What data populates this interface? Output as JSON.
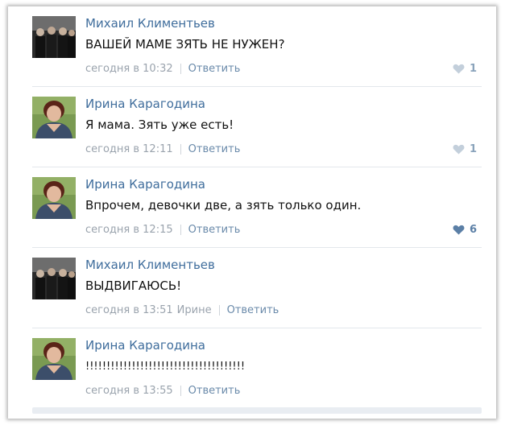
{
  "colors": {
    "author": "#3f6d9c",
    "meta": "#9aa3ad",
    "like_inactive": "#c3cfdb",
    "like_active": "#5b7fa6"
  },
  "comments": [
    {
      "author": "Михаил Климентьев",
      "avatar": "group-photo-avatar",
      "text": "ВАШЕЙ МАМЕ ЗЯТЬ НЕ НУЖЕН?",
      "time": "сегодня в 10:32",
      "reply_to": "",
      "reply_label": "Ответить",
      "likes": "1",
      "liked": false
    },
    {
      "author": "Ирина Карагодина",
      "avatar": "woman-portrait-avatar",
      "text": "Я мама. Зять уже есть!",
      "time": "сегодня в 12:11",
      "reply_to": "",
      "reply_label": "Ответить",
      "likes": "1",
      "liked": false
    },
    {
      "author": "Ирина Карагодина",
      "avatar": "woman-portrait-avatar",
      "text": "Впрочем, девочки две, а зять только один.",
      "time": "сегодня в 12:15",
      "reply_to": "",
      "reply_label": "Ответить",
      "likes": "6",
      "liked": true
    },
    {
      "author": "Михаил Климентьев",
      "avatar": "group-photo-avatar",
      "text": "ВЫДВИГАЮСЬ!",
      "time": "сегодня в 13:51",
      "reply_to": "Ирине",
      "reply_label": "Ответить",
      "likes": "",
      "liked": false
    },
    {
      "author": "Ирина Карагодина",
      "avatar": "woman-portrait-avatar",
      "text": "!!!!!!!!!!!!!!!!!!!!!!!!!!!!!!!!!!!!!!",
      "time": "сегодня в 13:55",
      "reply_to": "",
      "reply_label": "Ответить",
      "likes": "",
      "liked": false
    }
  ]
}
